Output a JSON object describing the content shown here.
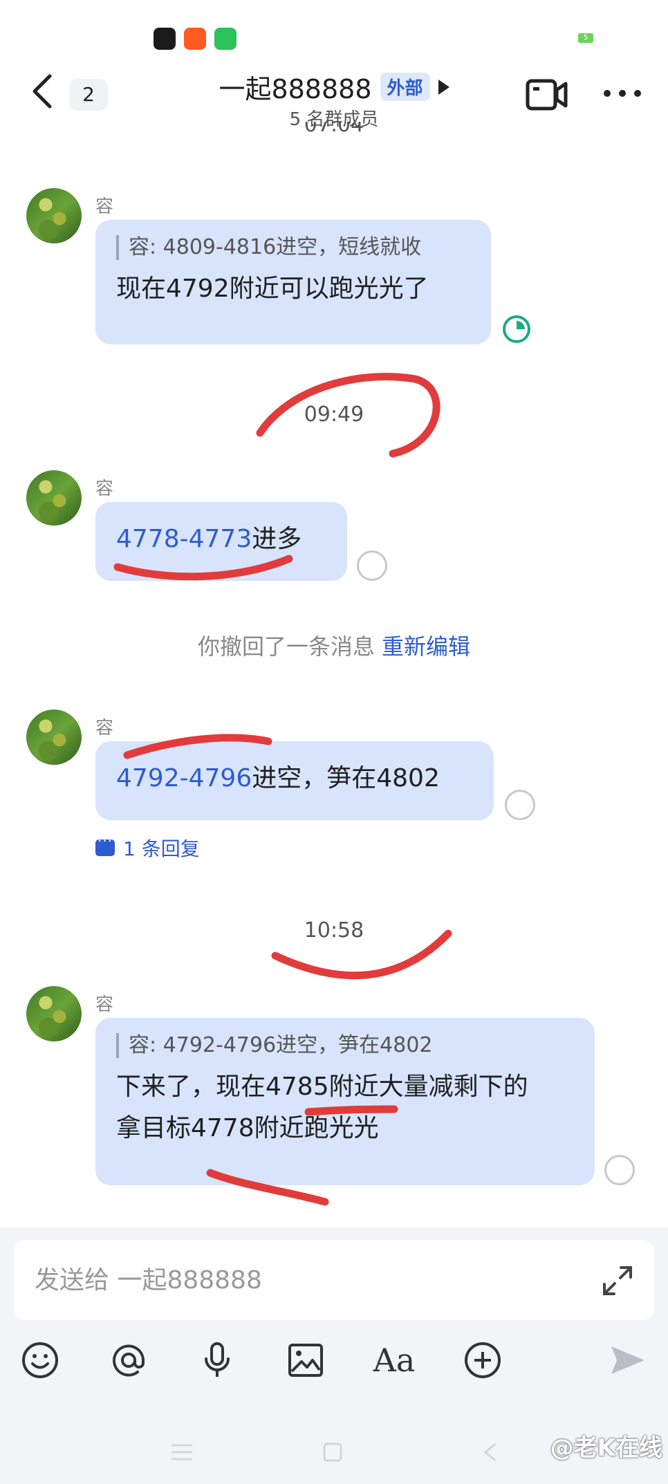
{
  "status_bar": {
    "apps": [
      "soul-app-icon",
      "taobao-app-icon",
      "wechat-app-icon"
    ],
    "battery": "5"
  },
  "header": {
    "unread_count": "2",
    "title": "一起888888",
    "tag": "外部",
    "subtitle": "5 名群成员",
    "partial_time": "07:04"
  },
  "messages": [
    {
      "sender": "容",
      "quote": "容: 4809-4816进空，短线就收",
      "text": "现在4792附近可以跑光光了",
      "status": "partially-read"
    },
    {
      "time": "09:49"
    },
    {
      "sender": "容",
      "link": "4778-4773",
      "text": "进多",
      "status": "unread"
    },
    {
      "recall_text": "你撤回了一条消息",
      "recall_action": "重新编辑"
    },
    {
      "sender": "容",
      "link": "4792-4796",
      "text": "进空，笋在4802",
      "status": "unread",
      "reply_count_text": "1 条回复"
    },
    {
      "time": "10:58"
    },
    {
      "sender": "容",
      "quote": "容: 4792-4796进空，笋在4802",
      "line1": "下来了，现在4785附近大量减剩下的",
      "line2": "拿目标4778附近跑光光",
      "status": "unread"
    }
  ],
  "input": {
    "placeholder": "发送给 一起888888"
  },
  "toolbar": [
    "emoji-icon",
    "mention-icon",
    "microphone-icon",
    "image-icon",
    "text-format-icon",
    "add-icon",
    "send-icon"
  ],
  "toolbar_text_format": "Aa",
  "watermark": "@老K在线",
  "colors": {
    "bubble": "#d7e4fc",
    "accent": "#2d5bd0",
    "annotation": "#e23b3b",
    "read_status": "#1aa88a"
  }
}
